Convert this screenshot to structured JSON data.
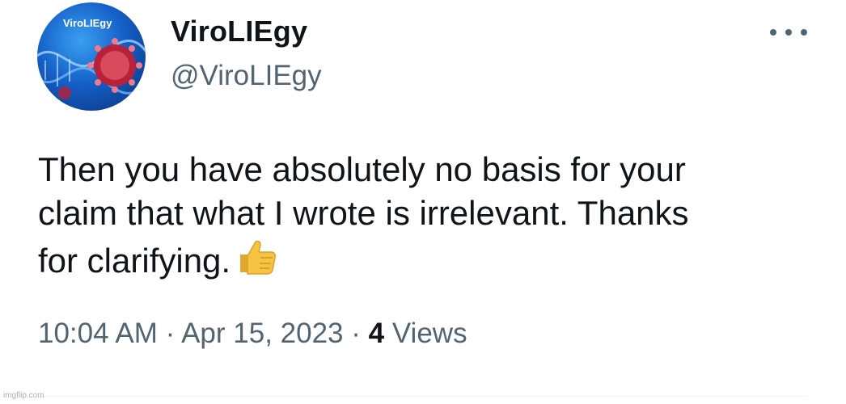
{
  "author": {
    "display_name": "ViroLIEgy",
    "handle": "@ViroLIEgy",
    "avatar_text": "ViroLIEgy",
    "avatar_icon": "virus-icon"
  },
  "more_icon": "more-options-icon",
  "tweet": {
    "lines": [
      "Then you have absolutely no basis for your",
      "claim that what I wrote is irrelevant. Thanks",
      "for clarifying."
    ],
    "emoji": "thumbs-up-icon"
  },
  "meta": {
    "time": "10:04 AM",
    "separator": "·",
    "date": "Apr 15, 2023",
    "views_count": "4",
    "views_label": "Views"
  },
  "watermark": "imgflip.com",
  "colors": {
    "text_primary": "#0f1419",
    "text_secondary": "#536471",
    "avatar_blue": "#1560c8",
    "virus_red": "#c0283a",
    "emoji_yellow": "#f6c342"
  }
}
